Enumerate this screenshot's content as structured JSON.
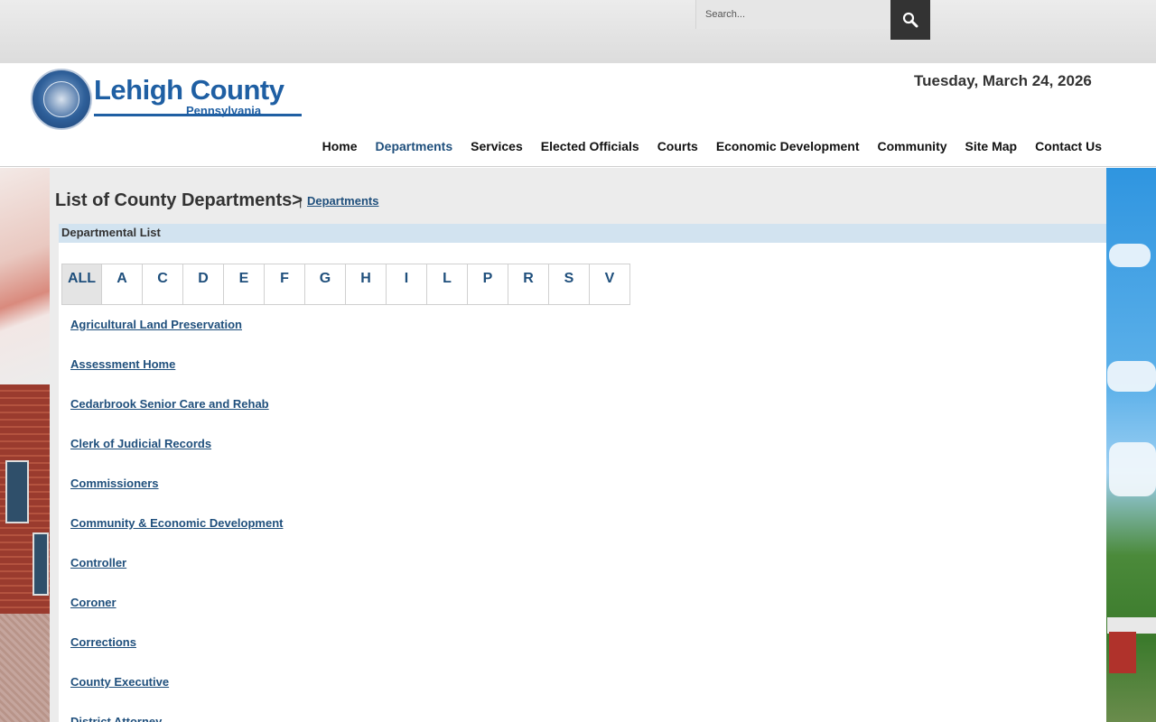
{
  "search": {
    "placeholder": "Search..."
  },
  "header": {
    "logo_title": "Lehigh County",
    "logo_subtitle": "Pennsylvania",
    "date": "Tuesday, March 24, 2026"
  },
  "nav": {
    "items": [
      {
        "label": "Home",
        "active": false
      },
      {
        "label": "Departments",
        "active": true
      },
      {
        "label": "Services",
        "active": false
      },
      {
        "label": "Elected Officials",
        "active": false
      },
      {
        "label": "Courts",
        "active": false
      },
      {
        "label": "Economic Development",
        "active": false
      },
      {
        "label": "Community",
        "active": false
      },
      {
        "label": "Site Map",
        "active": false
      },
      {
        "label": "Contact Us",
        "active": false
      }
    ]
  },
  "page": {
    "title": "List of County Departments>",
    "separator": "|",
    "breadcrumb_link": "Departments",
    "list_header": "Departmental List"
  },
  "letters": [
    "ALL",
    "A",
    "C",
    "D",
    "E",
    "F",
    "G",
    "H",
    "I",
    "L",
    "P",
    "R",
    "S",
    "V"
  ],
  "departments": [
    "Agricultural Land Preservation",
    "Assessment Home",
    "Cedarbrook Senior Care and Rehab",
    "Clerk of Judicial Records",
    "Commissioners",
    "Community & Economic Development",
    "Controller",
    "Coroner",
    "Corrections",
    "County Executive",
    "District Attorney"
  ],
  "colors": {
    "link": "#1f4f7c",
    "brand": "#1f5fa3",
    "list_header_bg": "#d2e3f0",
    "search_button": "#333333"
  }
}
